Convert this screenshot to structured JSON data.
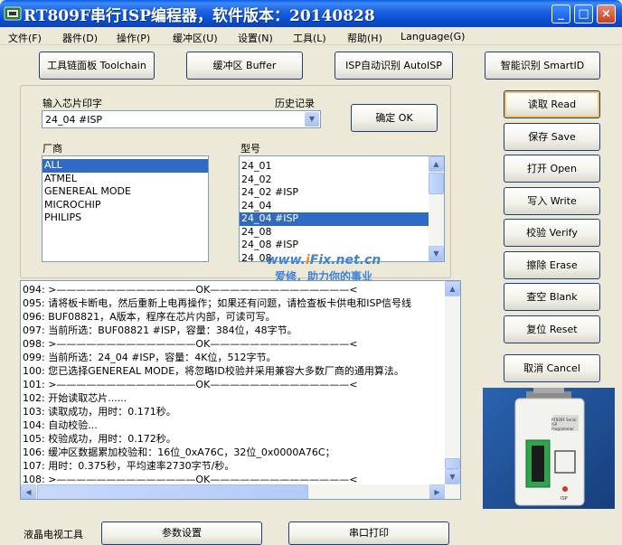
{
  "window": {
    "title": "RT809F串行ISP编程器，软件版本：20140828",
    "controls": [
      "_",
      "□",
      "×"
    ]
  },
  "menu": [
    "文件(F)",
    "器件(D)",
    "操作(P)",
    "缓冲区(U)",
    "设置(N)",
    "工具(L)",
    "帮助(H)",
    "Language(G)"
  ],
  "toolbar": {
    "toolchain": "工具链面板 Toolchain",
    "buffer": "缓冲区 Buffer",
    "auto_isp": "ISP自动识别 AutoISP",
    "smart_id": "智能识别 SmartID"
  },
  "chip_input": {
    "label": "输入芯片印字",
    "history_label": "历史记录",
    "value": "24_04 #ISP",
    "ok": "确定 OK"
  },
  "vendor": {
    "label": "厂商",
    "items": [
      "ALL",
      "ATMEL",
      "GENEREAL MODE",
      "MICROCHIP",
      "PHILIPS"
    ],
    "selected": 0
  },
  "model": {
    "label": "型号",
    "items": [
      "24_01",
      "24_02",
      "24_02 #ISP",
      "24_04",
      "24_04 #ISP",
      "24_08",
      "24_08 #ISP",
      "24_08"
    ],
    "selected": 4
  },
  "actions": {
    "read": "读取 Read",
    "save": "保存 Save",
    "open": "打开 Open",
    "write": "写入 Write",
    "verify": "校验 Verify",
    "erase": "擦除 Erase",
    "blank": "查空 Blank",
    "reset": "复位 Reset",
    "cancel": "取消 Cancel"
  },
  "log": [
    "094: >——————————————OK——————————————<",
    "095: 请将板卡断电，然后重新上电再操作；如果还有问题，请检查板卡供电和ISP信号线",
    "096: BUF08821，A版本，程序在芯片内部，可读可写。",
    "097: 当前所选：BUF08821 #ISP，容量：384位，48字节。",
    "098: >——————————————OK——————————————<",
    "099: 当前所选：24_04 #ISP，容量：4K位，512字节。",
    "100: 您已选择GENEREAL MODE，将忽略ID校验并采用兼容大多数厂商的通用算法。",
    "101: >——————————————OK——————————————<",
    "102: 开始读取芯片......",
    "103: 读取成功，用时：0.171秒。",
    "104: 自动校验...",
    "105: 校验成功，用时：0.172秒。",
    "106: 缓冲区数据累加校验和：16位_0xA76C，32位_0x0000A76C；",
    "107: 用时：0.375秒，平均速率2730字节/秒。",
    "108: >——————————————OK——————————————<"
  ],
  "watermark": {
    "www": "www.",
    "i": "i",
    "domain": "Fix.net.cn",
    "slogan": "爱修．助力你的事业"
  },
  "device_labels": {
    "name": "RT809F Serial ISP Programmer",
    "port": "ISP"
  },
  "bottom": {
    "lcd_tools": "液晶电视工具",
    "params": "参数设置",
    "serial_print": "串口打印"
  }
}
